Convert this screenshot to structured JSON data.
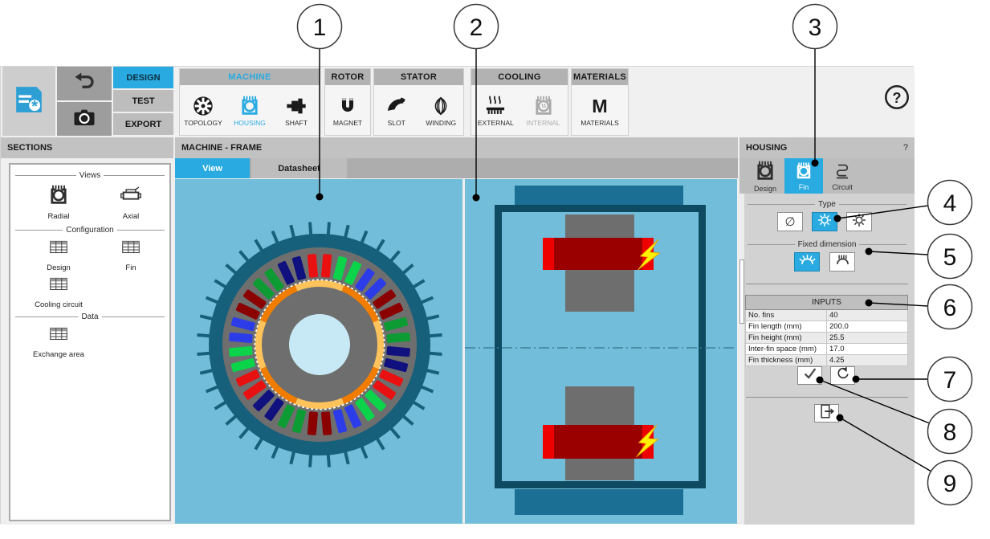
{
  "toolbar": {
    "design_label": "DESIGN",
    "test_label": "TEST",
    "export_label": "EXPORT"
  },
  "ribbon": {
    "groups": [
      {
        "title": "MACHINE",
        "items": [
          {
            "label": "TOPOLOGY"
          },
          {
            "label": "HOUSING"
          },
          {
            "label": "SHAFT"
          }
        ]
      },
      {
        "title": "ROTOR",
        "items": [
          {
            "label": "MAGNET"
          }
        ]
      },
      {
        "title": "STATOR",
        "items": [
          {
            "label": "SLOT"
          },
          {
            "label": "WINDING"
          }
        ]
      },
      {
        "title": "COOLING",
        "items": [
          {
            "label": "EXTERNAL"
          },
          {
            "label": "INTERNAL"
          }
        ]
      },
      {
        "title": "MATERIALS",
        "items": [
          {
            "label": "MATERIALS"
          }
        ]
      }
    ]
  },
  "sections_panel": {
    "title": "SECTIONS",
    "groups": [
      {
        "legend": "Views",
        "items": [
          {
            "label": "Radial"
          },
          {
            "label": "Axial"
          }
        ]
      },
      {
        "legend": "Configuration",
        "items": [
          {
            "label": "Design"
          },
          {
            "label": "Fin"
          },
          {
            "label": "Cooling circuit"
          }
        ]
      },
      {
        "legend": "Data",
        "items": [
          {
            "label": "Exchange area"
          }
        ]
      }
    ]
  },
  "main": {
    "title": "MACHINE - FRAME",
    "tabs": [
      {
        "label": "View"
      },
      {
        "label": "Datasheet"
      }
    ]
  },
  "housing_panel": {
    "title": "HOUSING",
    "help_glyph": "?",
    "tabs": [
      {
        "label": "Design"
      },
      {
        "label": "Fin"
      },
      {
        "label": "Circuit"
      }
    ],
    "type_legend": "Type",
    "no_fin_glyph": "∅",
    "fixed_legend": "Fixed dimension",
    "inputs": {
      "header": "INPUTS",
      "rows": [
        {
          "label": "No. fins",
          "value": "40"
        },
        {
          "label": "Fin length (mm)",
          "value": "200.0"
        },
        {
          "label": "Fin height (mm)",
          "value": "25.5"
        },
        {
          "label": "Inter-fin space (mm)",
          "value": "17.0"
        },
        {
          "label": "Fin thickness (mm)",
          "value": "4.25"
        }
      ]
    }
  },
  "callouts": [
    {
      "n": "1"
    },
    {
      "n": "2"
    },
    {
      "n": "3"
    },
    {
      "n": "4"
    },
    {
      "n": "5"
    },
    {
      "n": "6"
    },
    {
      "n": "7"
    },
    {
      "n": "8"
    },
    {
      "n": "9"
    }
  ],
  "help_glyph": "?",
  "colors": {
    "accent_blue": "#29ABE2",
    "view_bg": "#72BEDA",
    "housing_teal": "#17607B",
    "frame_dark_teal": "#0E4A61",
    "frame_block_blue": "#1B6F95",
    "steel_gray": "#6E6E6E",
    "shaft_light_blue": "#C7E9F5",
    "magnet_orange": "#F07D00",
    "magnet_light_orange": "#FFC35C",
    "winding_dark_red": "#9B0000",
    "winding_bright_red": "#EE0000",
    "bolt_yellow": "#FFF200",
    "centerline_blue": "#3D7E99",
    "icon_dark": "#1A1A1A"
  },
  "machine_views": {
    "radial": {
      "fin_count": 40,
      "slot_count": 36,
      "slot_colors": [
        "#E81010",
        "#0BD44B",
        "#2B3CE8",
        "#8B0000",
        "#0D9B33",
        "#10107E"
      ]
    },
    "axial": {
      "fault_bolts": 2
    }
  }
}
